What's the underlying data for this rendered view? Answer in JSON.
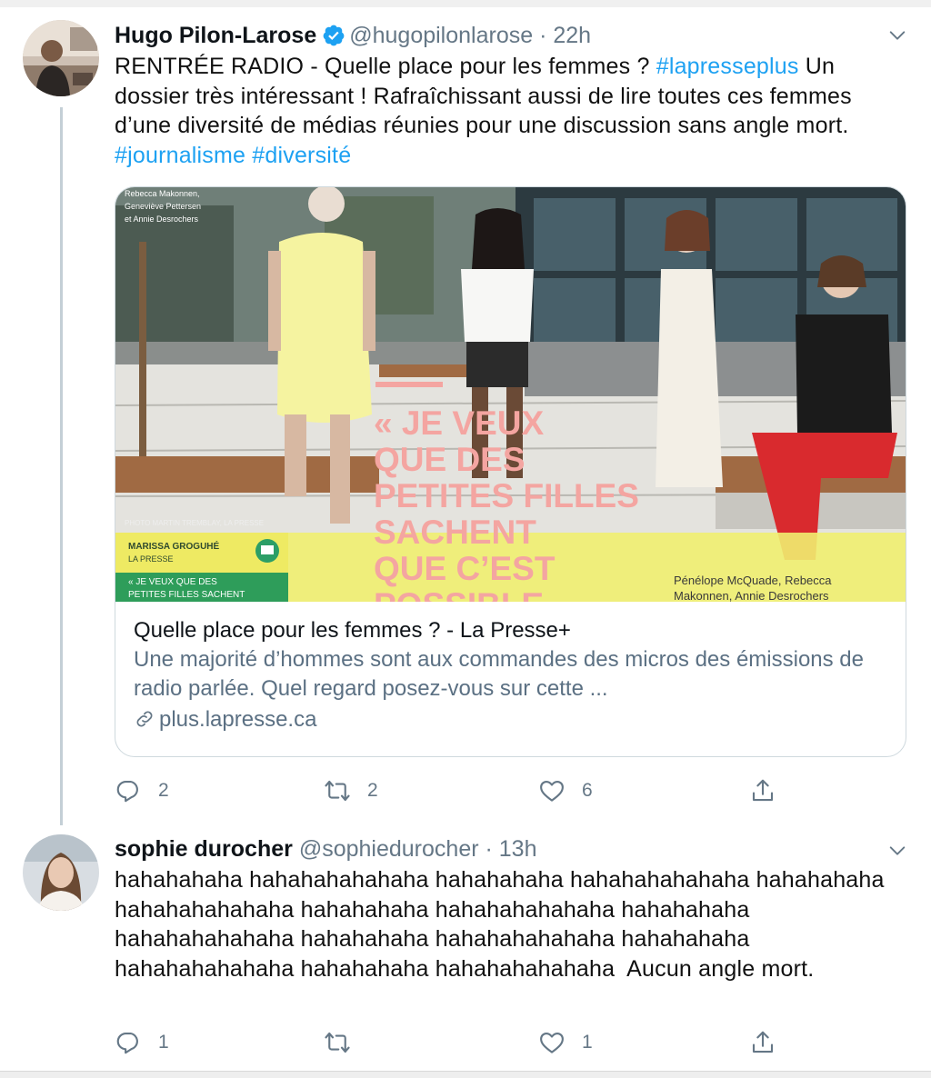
{
  "tweet1": {
    "display_name": "Hugo Pilon-Larose",
    "handle": "@hugopilonlarose",
    "separator": "·",
    "time": "22h",
    "verified": true,
    "text_segments": [
      {
        "text": "RENTRÉE RADIO - Quelle place pour les femmes ? ",
        "type": "text"
      },
      {
        "text": "#lapresseplus",
        "type": "hashtag"
      },
      {
        "text": " Un dossier très intéressant ! Rafraîchissant aussi de lire toutes ces femmes d’une diversité de médias réunies pour une discussion sans angle mort. ",
        "type": "text"
      },
      {
        "text": "#journalisme",
        "type": "hashtag"
      },
      {
        "text": " ",
        "type": "text"
      },
      {
        "text": "#diversité",
        "type": "hashtag"
      }
    ],
    "card": {
      "image": {
        "caption_top": "Rebecca Makonnen, Geneviève Pettersen et Annie Desrochers",
        "photo_credit": "PHOTO MARTIN TREMBLAY, LA PRESSE",
        "author_name": "MARISSA GROGUHÉ",
        "author_outlet": "LA PRESSE",
        "teaser": "« JE VEUX QUE DES PETITES FILLES SACHENT",
        "quote": "« JE VEUX QUE DES PETITES FILLES SACHENT QUE C’EST POSSIBLE",
        "names_caption": "Pénélope McQuade, Rebecca Makonnen, Annie Desrochers"
      },
      "title": "Quelle place pour les femmes ? - La Presse+",
      "description": "Une majorité d’hommes sont aux commandes des micros des émissions de radio parlée. Quel regard posez-vous sur cette ...",
      "domain": "plus.lapresse.ca"
    },
    "actions": {
      "replies": "2",
      "retweets": "2",
      "likes": "6"
    }
  },
  "tweet2": {
    "display_name": "sophie durocher",
    "handle": "@sophiedurocher",
    "separator": "·",
    "time": "13h",
    "text": "hahahahaha hahahahahahaha hahahahaha hahahahahahaha hahahahaha hahahahahahaha hahahahaha hahahahahahaha hahahahaha hahahahahahaha hahahahaha hahahahahahaha hahahahaha hahahahahahaha hahahahaha hahahahahahaha  Aucun angle mort.",
    "actions": {
      "replies": "1",
      "retweets": "",
      "likes": "1"
    }
  },
  "colors": {
    "link": "#1da1f2",
    "secondary_text": "#657786",
    "card_border": "#cfd9de",
    "photo_banner": "#f0ee70",
    "quote_pink": "#f4a5a1"
  },
  "icons": [
    "verified-badge-icon",
    "chevron-down-icon",
    "reply-icon",
    "retweet-icon",
    "like-icon",
    "share-icon",
    "link-icon"
  ]
}
